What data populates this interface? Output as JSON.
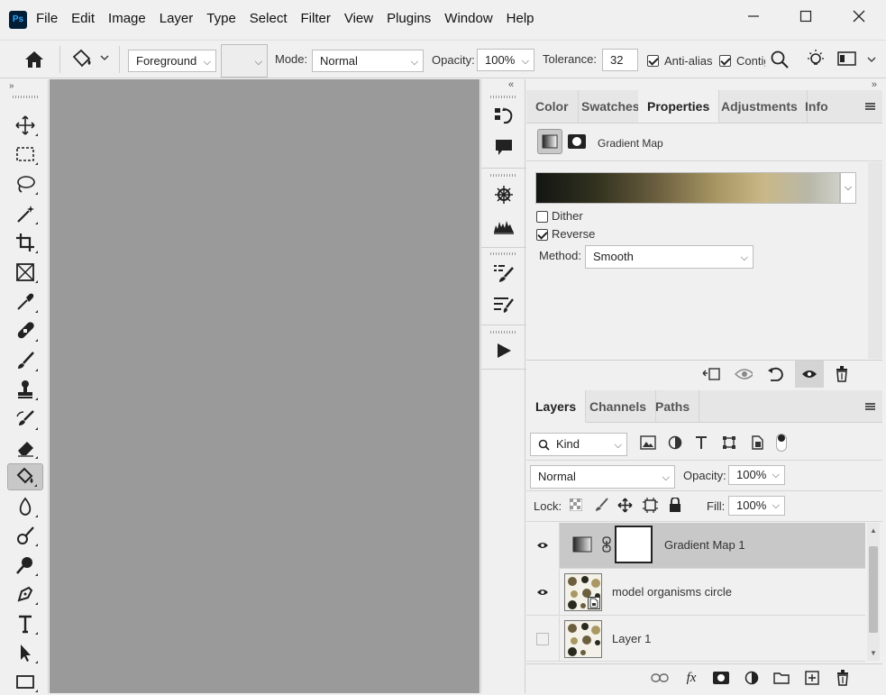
{
  "app": {
    "logo": "Ps"
  },
  "menu": [
    "File",
    "Edit",
    "Image",
    "Layer",
    "Type",
    "Select",
    "Filter",
    "View",
    "Plugins",
    "Window",
    "Help"
  ],
  "window_controls": {
    "minimize": "minimize-icon",
    "maximize": "maximize-icon",
    "close": "close-icon"
  },
  "options": {
    "fill_source": "Foreground",
    "mode_label": "Mode:",
    "mode_value": "Normal",
    "opacity_label": "Opacity:",
    "opacity_value": "100%",
    "tolerance_label": "Tolerance:",
    "tolerance_value": "32",
    "antialias_label": "Anti-alias",
    "antialias_checked": true,
    "contiguous_label": "Contig",
    "contiguous_checked": true
  },
  "properties_panel": {
    "tabs": [
      "Color",
      "Swatches",
      "Properties",
      "Adjustments",
      "Info"
    ],
    "active_tab": "Properties",
    "adjustment_name": "Gradient Map",
    "dither_label": "Dither",
    "dither_checked": false,
    "reverse_label": "Reverse",
    "reverse_checked": true,
    "method_label": "Method:",
    "method_value": "Smooth"
  },
  "layers_panel": {
    "tabs": [
      "Layers",
      "Channels",
      "Paths"
    ],
    "active_tab": "Layers",
    "filter_kind": "Kind",
    "blend_mode": "Normal",
    "opacity_label": "Opacity:",
    "opacity_value": "100%",
    "lock_label": "Lock:",
    "fill_label": "Fill:",
    "fill_value": "100%",
    "layers": [
      {
        "name": "Gradient Map 1",
        "visible": true,
        "selected": true
      },
      {
        "name": "model organisms circle",
        "visible": true,
        "selected": false
      },
      {
        "name": "Layer 1",
        "visible": false,
        "selected": false
      }
    ]
  },
  "colors": {
    "canvas": "#9a9a9a",
    "panel": "#f0f0f0",
    "selected_layer": "#c8c8c8"
  }
}
